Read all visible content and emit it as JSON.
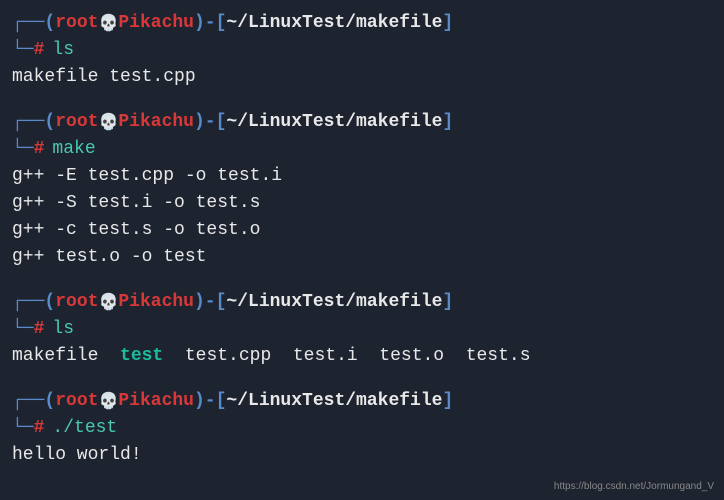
{
  "user": "root",
  "host": "Pikachu",
  "path": "~/LinuxTest/makefile",
  "skull": "💀",
  "blocks": [
    {
      "command": "ls",
      "outputs": [
        "makefile  test.cpp"
      ],
      "highlightWords": []
    },
    {
      "command": "make",
      "outputs": [
        "g++ -E test.cpp -o test.i",
        "g++ -S test.i -o test.s",
        "g++ -c test.s -o test.o",
        "g++ test.o -o test"
      ],
      "highlightWords": []
    },
    {
      "command": "ls",
      "outputs": [
        "makefile  test  test.cpp  test.i  test.o  test.s"
      ],
      "highlightWords": [
        "test"
      ]
    },
    {
      "command": "./test",
      "outputs": [
        "hello world!"
      ],
      "highlightWords": []
    }
  ],
  "watermark": "https://blog.csdn.net/Jormungand_V"
}
